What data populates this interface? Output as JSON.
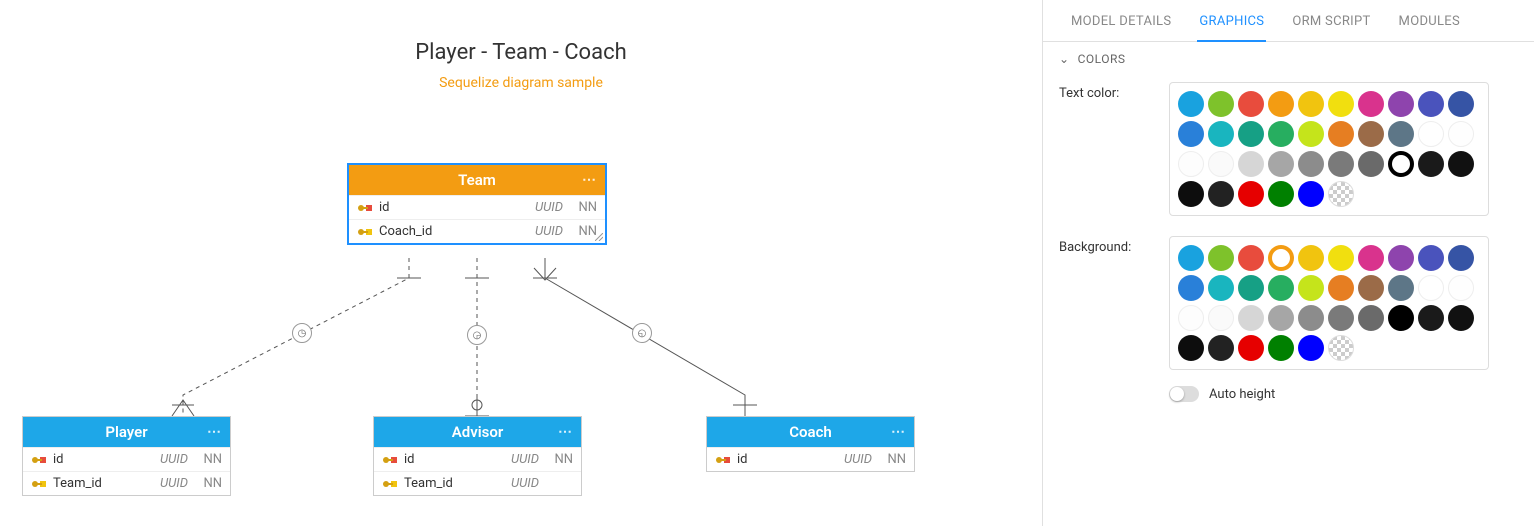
{
  "diagram": {
    "title": "Player - Team - Coach",
    "subtitle": "Sequelize diagram sample",
    "entities": {
      "team": {
        "name": "Team",
        "selected": true,
        "header_color": "#f39c12",
        "columns": [
          {
            "key": "pk",
            "name": "id",
            "type": "UUID",
            "nn": "NN"
          },
          {
            "key": "fk",
            "name": "Coach_id",
            "type": "UUID",
            "nn": "NN"
          }
        ]
      },
      "player": {
        "name": "Player",
        "header_color": "#1ea7e8",
        "columns": [
          {
            "key": "pk",
            "name": "id",
            "type": "UUID",
            "nn": "NN"
          },
          {
            "key": "fk",
            "name": "Team_id",
            "type": "UUID",
            "nn": "NN"
          }
        ]
      },
      "advisor": {
        "name": "Advisor",
        "header_color": "#1ea7e8",
        "columns": [
          {
            "key": "pk",
            "name": "id",
            "type": "UUID",
            "nn": "NN"
          },
          {
            "key": "fk",
            "name": "Team_id",
            "type": "UUID",
            "nn": ""
          }
        ]
      },
      "coach": {
        "name": "Coach",
        "header_color": "#1ea7e8",
        "columns": [
          {
            "key": "pk",
            "name": "id",
            "type": "UUID",
            "nn": "NN"
          }
        ]
      }
    },
    "relations": [
      {
        "from": "team",
        "to": "player",
        "style": "dashed"
      },
      {
        "from": "team",
        "to": "advisor",
        "style": "dashed"
      },
      {
        "from": "team",
        "to": "coach",
        "style": "solid"
      }
    ]
  },
  "panel": {
    "tabs": {
      "model_details": "MODEL DETAILS",
      "graphics": "GRAPHICS",
      "orm_script": "ORM SCRIPT",
      "modules": "MODULES",
      "active": "graphics"
    },
    "section_colors_label": "COLORS",
    "text_color_label": "Text color:",
    "background_label": "Background:",
    "auto_height_label": "Auto height",
    "auto_height_on": false,
    "text_color_selected": "#000000",
    "background_selected": "#f39c12",
    "palette": [
      "#19a2df",
      "#7ec22b",
      "#e84c3d",
      "#f39c12",
      "#f1c40f",
      "#f1df0f",
      "#d9338d",
      "#8e44ad",
      "#4a53bc",
      "#3654a5",
      "#2980d9",
      "#19b5bf",
      "#16a085",
      "#27ae60",
      "#c5e41b",
      "#e67e22",
      "#9b6b48",
      "#5d7687",
      "#ffffff",
      "#fefefe",
      "#fdfdfd",
      "#fafafa",
      "#d6d6d6",
      "#a6a6a6",
      "#8c8c8c",
      "#7a7a7a",
      "#6a6a6a",
      "#000000",
      "#1a1a1a",
      "#111111",
      "#0d0d0d",
      "#222222",
      "#e60000",
      "#008000",
      "#0000ff",
      "transparent"
    ]
  }
}
